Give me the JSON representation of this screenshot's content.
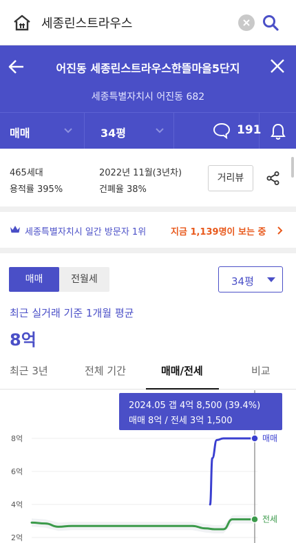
{
  "search": {
    "query": "세종린스트라우스"
  },
  "header": {
    "title": "어진동 세종린스트라우스한뜰마을5단지",
    "address": "세종특별자치시 어진동 682",
    "deal_type": "매매",
    "size": "34평",
    "comment_count": "191"
  },
  "summary": {
    "households": "465세대",
    "built": "2022년 11월(3년차)",
    "far": "용적률 395%",
    "bcr": "건폐율 38%",
    "road_view": "거리뷰"
  },
  "visitor": {
    "text": "세종특별자치시 일간 방문자 1위",
    "highlight": "지금 1,139명이 보는 중"
  },
  "filter": {
    "options": [
      "매매",
      "전월세"
    ],
    "selected_size": "34평"
  },
  "price_summary": {
    "label": "최근 실거래 기준 1개월 평균",
    "value": "8억"
  },
  "period_tabs": [
    "최근 3년",
    "전체 기간",
    "매매/전세",
    "비교"
  ],
  "tooltip": {
    "line1": "2024.05  갭 4억 8,500 (39.4%)",
    "line2": "매매 8억 / 전세 3억 1,500"
  },
  "colors": {
    "accent": "#4a4fc7",
    "sale": "#3a3fd0",
    "jeonse": "#3b9a4a",
    "highlight": "#e8591c"
  },
  "chart_data": {
    "type": "line",
    "y_ticks": [
      "8억",
      "6억",
      "4억",
      "2억"
    ],
    "y_tick_values": [
      8,
      6,
      4,
      2
    ],
    "ylim": [
      1.9,
      8.2
    ],
    "series": [
      {
        "name": "매매",
        "color": "#3a3fd0",
        "points": [
          [
            0.8,
            4.0
          ],
          [
            0.81,
            6.8
          ],
          [
            0.83,
            7.9
          ],
          [
            0.86,
            8.0
          ],
          [
            1.0,
            8.0
          ]
        ]
      },
      {
        "name": "전세",
        "color": "#3b9a4a",
        "points": [
          [
            0.0,
            2.9
          ],
          [
            0.06,
            2.85
          ],
          [
            0.12,
            2.65
          ],
          [
            0.18,
            2.7
          ],
          [
            0.24,
            2.7
          ],
          [
            0.3,
            2.7
          ],
          [
            0.36,
            2.7
          ],
          [
            0.42,
            2.7
          ],
          [
            0.48,
            2.7
          ],
          [
            0.54,
            2.7
          ],
          [
            0.6,
            2.7
          ],
          [
            0.66,
            2.7
          ],
          [
            0.72,
            2.7
          ],
          [
            0.78,
            2.55
          ],
          [
            0.82,
            2.5
          ],
          [
            0.86,
            2.5
          ],
          [
            0.9,
            3.1
          ],
          [
            0.94,
            3.1
          ],
          [
            1.0,
            3.1
          ]
        ]
      }
    ],
    "marker_x": 1.0
  }
}
